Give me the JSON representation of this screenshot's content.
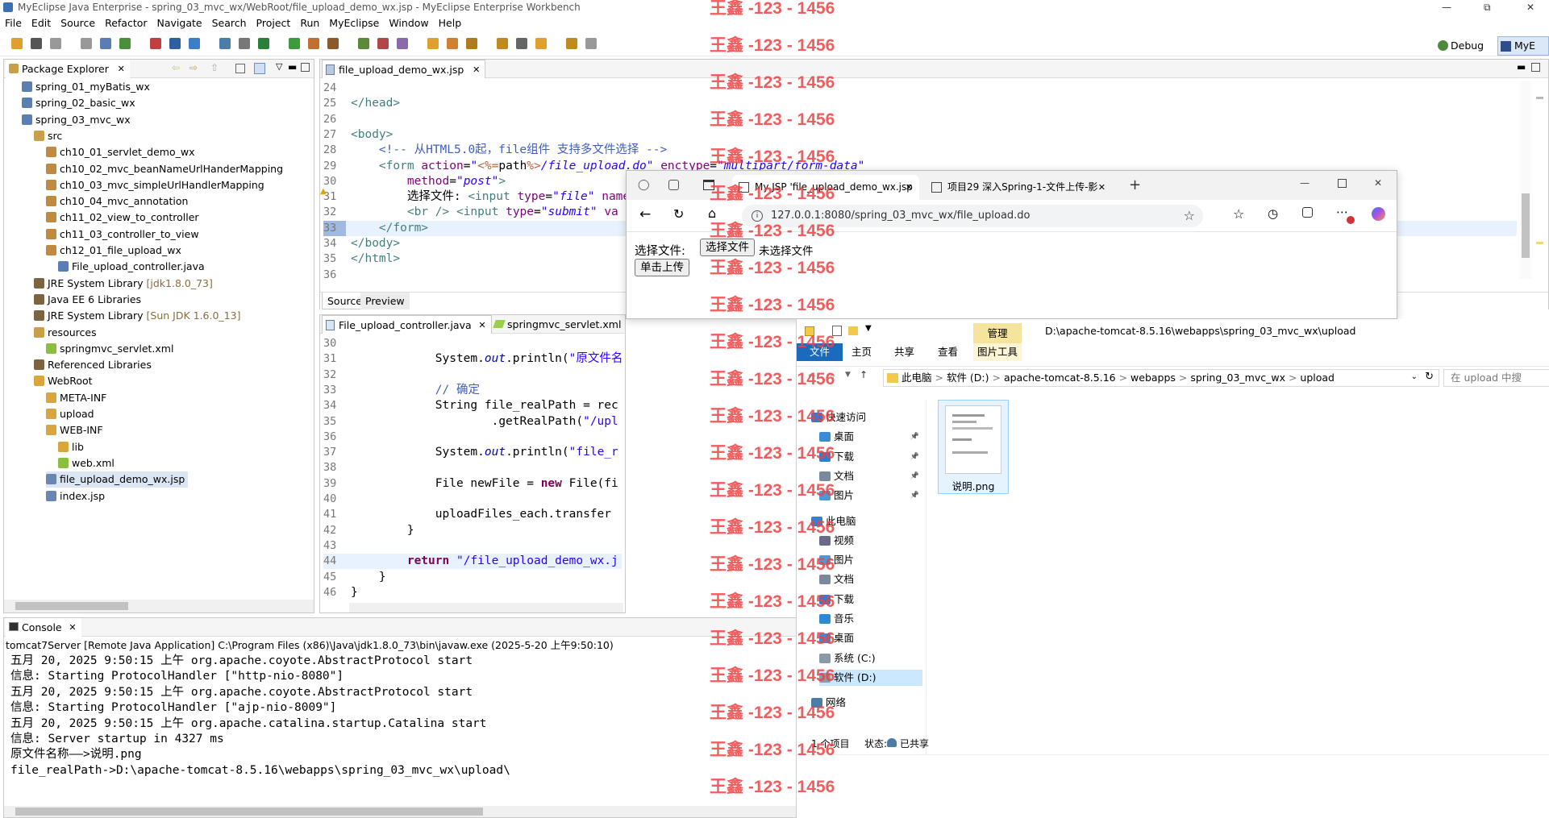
{
  "app_title": "MyEclipse Java Enterprise - spring_03_mvc_wx/WebRoot/file_upload_demo_wx.jsp - MyEclipse Enterprise Workbench",
  "menu": [
    "File",
    "Edit",
    "Source",
    "Refactor",
    "Navigate",
    "Search",
    "Project",
    "Run",
    "MyEclipse",
    "Window",
    "Help"
  ],
  "perspectives": {
    "debug": "Debug",
    "myeclipse": "MyE"
  },
  "package_explorer": {
    "title": "Package Explorer",
    "items": [
      {
        "label": "spring_01_myBatis_wx",
        "indent": 0,
        "icon": "project",
        "suffix": ""
      },
      {
        "label": "spring_02_basic_wx",
        "indent": 0,
        "icon": "project",
        "suffix": ""
      },
      {
        "label": "spring_03_mvc_wx",
        "indent": 0,
        "icon": "project",
        "suffix": ""
      },
      {
        "label": "src",
        "indent": 1,
        "icon": "source-folder",
        "suffix": ""
      },
      {
        "label": "ch10_01_servlet_demo_wx",
        "indent": 2,
        "icon": "package",
        "suffix": ""
      },
      {
        "label": "ch10_02_mvc_beanNameUrlHanderMapping",
        "indent": 2,
        "icon": "package",
        "suffix": ""
      },
      {
        "label": "ch10_03_mvc_simpleUrlHandlerMapping",
        "indent": 2,
        "icon": "package",
        "suffix": ""
      },
      {
        "label": "ch10_04_mvc_annotation",
        "indent": 2,
        "icon": "package",
        "suffix": ""
      },
      {
        "label": "ch11_02_view_to_controller",
        "indent": 2,
        "icon": "package",
        "suffix": ""
      },
      {
        "label": "ch11_03_controller_to_view",
        "indent": 2,
        "icon": "package",
        "suffix": ""
      },
      {
        "label": "ch12_01_file_upload_wx",
        "indent": 2,
        "icon": "package",
        "suffix": ""
      },
      {
        "label": "File_upload_controller.java",
        "indent": 3,
        "icon": "java-file",
        "suffix": ""
      },
      {
        "label": "JRE System Library",
        "indent": 1,
        "icon": "library",
        "suffix": "[jdk1.8.0_73]"
      },
      {
        "label": "Java EE 6 Libraries",
        "indent": 1,
        "icon": "library",
        "suffix": ""
      },
      {
        "label": "JRE System Library",
        "indent": 1,
        "icon": "library",
        "suffix": "[Sun JDK 1.6.0_13]"
      },
      {
        "label": "resources",
        "indent": 1,
        "icon": "source-folder",
        "suffix": ""
      },
      {
        "label": "springmvc_servlet.xml",
        "indent": 2,
        "icon": "xml-file",
        "suffix": ""
      },
      {
        "label": "Referenced Libraries",
        "indent": 1,
        "icon": "library",
        "suffix": ""
      },
      {
        "label": "WebRoot",
        "indent": 1,
        "icon": "folder",
        "suffix": ""
      },
      {
        "label": "META-INF",
        "indent": 2,
        "icon": "folder",
        "suffix": ""
      },
      {
        "label": "upload",
        "indent": 2,
        "icon": "folder",
        "suffix": ""
      },
      {
        "label": "WEB-INF",
        "indent": 2,
        "icon": "folder",
        "suffix": ""
      },
      {
        "label": "lib",
        "indent": 3,
        "icon": "folder",
        "suffix": ""
      },
      {
        "label": "web.xml",
        "indent": 3,
        "icon": "xml-file",
        "suffix": ""
      },
      {
        "label": "file_upload_demo_wx.jsp",
        "indent": 2,
        "icon": "jsp-file",
        "suffix": "",
        "selected": true
      },
      {
        "label": "index.jsp",
        "indent": 2,
        "icon": "jsp-file",
        "suffix": ""
      }
    ]
  },
  "jsp_editor": {
    "tab": "file_upload_demo_wx.jsp",
    "bottom_tabs": [
      "Source",
      "Preview"
    ],
    "lines": [
      {
        "n": "24",
        "html": ""
      },
      {
        "n": "25",
        "html": "<span class='tagc'>&lt;/head&gt;</span>"
      },
      {
        "n": "26",
        "html": ""
      },
      {
        "n": "27",
        "html": "<span class='tagc'>&lt;body&gt;</span>"
      },
      {
        "n": "28",
        "html": "    <span class='com'>&lt;!-- 从HTML5.0起，file组件 支持多文件选择 --&gt;</span>"
      },
      {
        "n": "29",
        "html": "    <span class='tagc'>&lt;form</span> <span class='attr'>action</span>=<span class='str'>\"</span><span class='pct'>&lt;%=</span>path<span class='pct'>%&gt;</span><span class='str'>/file_upload.do\"</span> <span class='attr'>enctype</span>=<span class='str'>\"multipart/form-data\"</span>"
      },
      {
        "n": "30",
        "html": "        <span class='attr'>method</span>=<span class='str'>\"post\"</span><span class='tagc'>&gt;</span>"
      },
      {
        "n": "31",
        "html": "        选择文件: <span class='tagc'>&lt;input</span> <span class='attr'>type</span>=<span class='str'>\"file\"</span> <span class='attr'>name</span>"
      },
      {
        "n": "32",
        "html": "        <span class='tagc'>&lt;br /&gt;</span> <span class='tagc'>&lt;input</span> <span class='attr'>type</span>=<span class='str'>\"submit\"</span> <span class='attr'>va</span>"
      },
      {
        "n": "33",
        "html": "    <span class='tagc'>&lt;/form&gt;</span>"
      },
      {
        "n": "34",
        "html": "<span class='tagc'>&lt;/body&gt;</span>"
      },
      {
        "n": "35",
        "html": "<span class='tagc'>&lt;/html&gt;</span>"
      },
      {
        "n": "36",
        "html": ""
      }
    ]
  },
  "java_editor": {
    "tabs": [
      "File_upload_controller.java",
      "springmvc_servlet.xml"
    ],
    "lines": [
      {
        "n": "30",
        "html": ""
      },
      {
        "n": "31",
        "html": "            System.<span class='fld'>out</span>.println(<span class='str' style='font-style:normal'>\"原文件名</span>"
      },
      {
        "n": "32",
        "html": ""
      },
      {
        "n": "33",
        "html": "            <span class='com'>// 确定</span>"
      },
      {
        "n": "34",
        "html": "            String file_realPath = rec"
      },
      {
        "n": "35",
        "html": "                    .getRealPath(<span class='str' style='font-style:normal'>\"/upl</span>"
      },
      {
        "n": "36",
        "html": ""
      },
      {
        "n": "37",
        "html": "            System.<span class='fld'>out</span>.println(<span class='str' style='font-style:normal'>\"file_r</span>"
      },
      {
        "n": "38",
        "html": ""
      },
      {
        "n": "39",
        "html": "            File newFile = <span class='kw'>new</span> File(fi"
      },
      {
        "n": "40",
        "html": ""
      },
      {
        "n": "41",
        "html": "            uploadFiles_each.transfer"
      },
      {
        "n": "42",
        "html": "        }"
      },
      {
        "n": "43",
        "html": ""
      },
      {
        "n": "44",
        "html": "        <span class='kw'>return</span> <span class='str' style='font-style:normal'>\"/file_upload_demo_wx.j</span>"
      },
      {
        "n": "45",
        "html": "    }"
      },
      {
        "n": "46",
        "html": "}"
      }
    ]
  },
  "console": {
    "title": "Console",
    "launch": "tomcat7Server [Remote Java Application] C:\\Program Files (x86)\\Java\\jdk1.8.0_73\\bin\\javaw.exe (2025-5-20 上午9:50:10)",
    "lines": [
      "五月 20, 2025 9:50:15 上午 org.apache.coyote.AbstractProtocol start",
      "信息: Starting ProtocolHandler [\"http-nio-8080\"]",
      "五月 20, 2025 9:50:15 上午 org.apache.coyote.AbstractProtocol start",
      "信息: Starting ProtocolHandler [\"ajp-nio-8009\"]",
      "五月 20, 2025 9:50:15 上午 org.apache.catalina.startup.Catalina start",
      "信息: Server startup in 4327 ms",
      "原文件名称——>说明.png",
      "file_realPath->D:\\apache-tomcat-8.5.16\\webapps\\spring_03_mvc_wx\\upload\\"
    ]
  },
  "browser": {
    "tabs": [
      "My JSP 'file_upload_demo_wx.jsp",
      "项目29 深入Spring-1-文件上传-影"
    ],
    "url": "127.0.0.1:8080/spring_03_mvc_wx/file_upload.do",
    "page": {
      "label": "选择文件:",
      "choose_btn": "选择文件",
      "no_file": "未选择文件",
      "submit": "单击上传"
    }
  },
  "explorer": {
    "manage_tab": "管理",
    "path_title": "D:\\apache-tomcat-8.5.16\\webapps\\spring_03_mvc_wx\\upload",
    "ribbon_tabs": [
      "文件",
      "主页",
      "共享",
      "查看",
      "图片工具"
    ],
    "breadcrumb": [
      "此电脑",
      "软件 (D:)",
      "apache-tomcat-8.5.16",
      "webapps",
      "spring_03_mvc_wx",
      "upload"
    ],
    "search_placeholder": "在 upload 中搜",
    "nav": [
      {
        "label": "快速访问",
        "indent": 0,
        "icon": "star",
        "pin": false
      },
      {
        "label": "桌面",
        "indent": 1,
        "icon": "desktop",
        "pin": true
      },
      {
        "label": "下载",
        "indent": 1,
        "icon": "download",
        "pin": true
      },
      {
        "label": "文档",
        "indent": 1,
        "icon": "document",
        "pin": true
      },
      {
        "label": "图片",
        "indent": 1,
        "icon": "picture",
        "pin": true
      },
      {
        "label": "此电脑",
        "indent": 0,
        "icon": "computer",
        "pin": false
      },
      {
        "label": "视频",
        "indent": 1,
        "icon": "video",
        "pin": false
      },
      {
        "label": "图片",
        "indent": 1,
        "icon": "picture",
        "pin": false
      },
      {
        "label": "文档",
        "indent": 1,
        "icon": "document",
        "pin": false
      },
      {
        "label": "下载",
        "indent": 1,
        "icon": "download",
        "pin": false
      },
      {
        "label": "音乐",
        "indent": 1,
        "icon": "music",
        "pin": false
      },
      {
        "label": "桌面",
        "indent": 1,
        "icon": "desktop",
        "pin": false
      },
      {
        "label": "系统 (C:)",
        "indent": 1,
        "icon": "drive",
        "pin": false
      },
      {
        "label": "软件 (D:)",
        "indent": 1,
        "icon": "drive",
        "pin": false,
        "selected": true
      },
      {
        "label": "网络",
        "indent": 0,
        "icon": "network",
        "pin": false
      }
    ],
    "file": {
      "name": "说明.png"
    },
    "status_count": "1 个项目",
    "status_label": "状态:",
    "status_value": "已共享"
  },
  "watermark": "王鑫 -123 - 1456"
}
